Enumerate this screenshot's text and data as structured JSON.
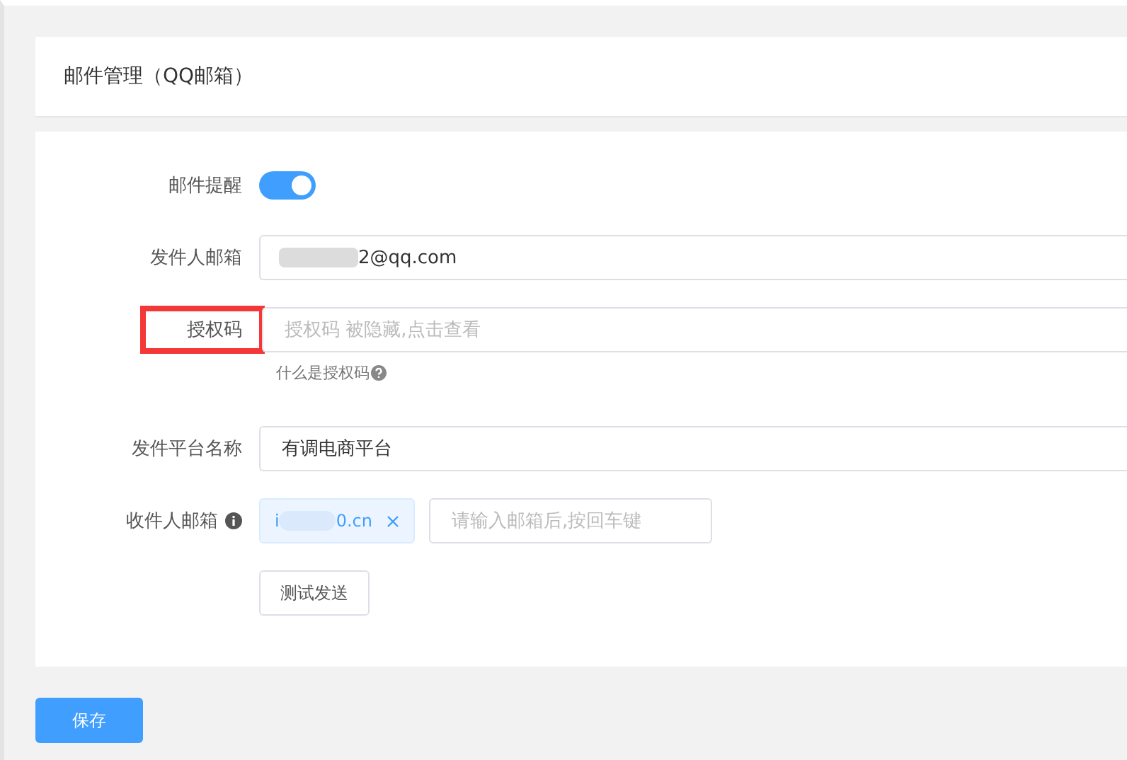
{
  "header": {
    "title": "邮件管理（QQ邮箱）"
  },
  "form": {
    "notify": {
      "label": "邮件提醒",
      "on": true
    },
    "sender": {
      "label": "发件人邮箱",
      "value": "2@qq.com",
      "redacted": true
    },
    "auth_code": {
      "label": "授权码",
      "highlighted": true,
      "placeholder": "授权码 被隐藏,点击查看",
      "help": "什么是授权码"
    },
    "platform": {
      "label": "发件平台名称",
      "value": "有调电商平台"
    },
    "recipients": {
      "label": "收件人邮箱",
      "tags": [
        {
          "start": "i",
          "end": "0.cn"
        }
      ],
      "placeholder": "请输入邮箱后,按回车键"
    },
    "test_button": "测试发送"
  },
  "save_button": "保存"
}
